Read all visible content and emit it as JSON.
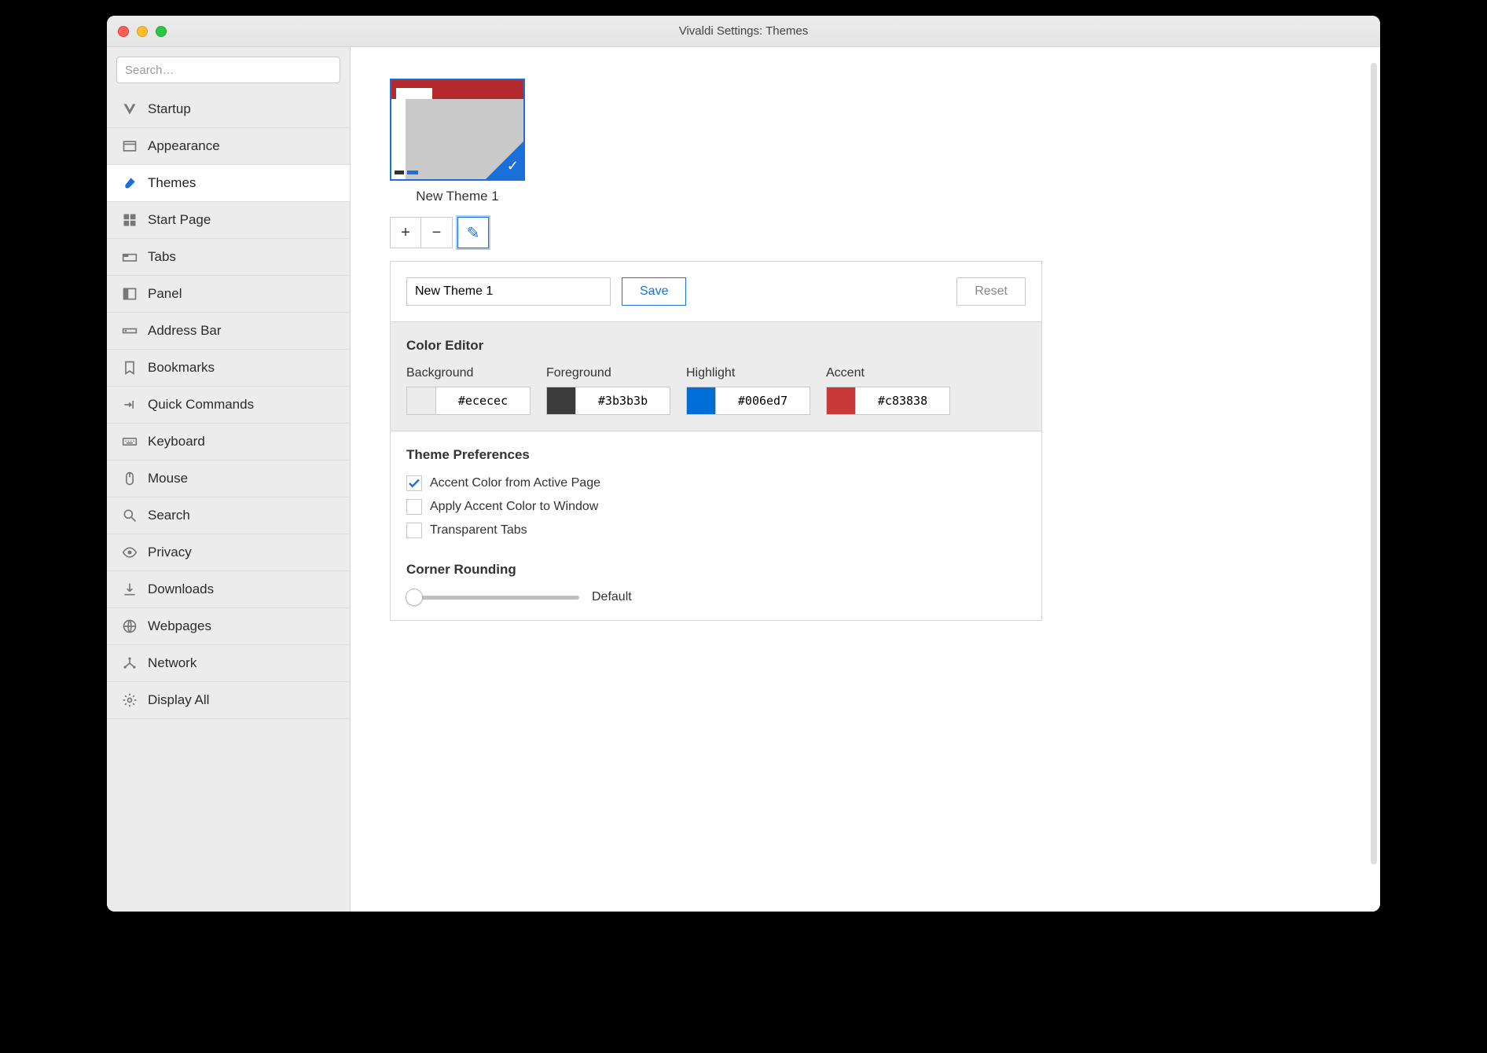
{
  "window": {
    "title": "Vivaldi Settings: Themes"
  },
  "search": {
    "placeholder": "Search…"
  },
  "sidebar": {
    "items": [
      {
        "label": "Startup",
        "icon": "vivaldi-icon"
      },
      {
        "label": "Appearance",
        "icon": "window-icon"
      },
      {
        "label": "Themes",
        "icon": "brush-icon",
        "active": true
      },
      {
        "label": "Start Page",
        "icon": "grid-icon"
      },
      {
        "label": "Tabs",
        "icon": "tabs-icon"
      },
      {
        "label": "Panel",
        "icon": "panel-icon"
      },
      {
        "label": "Address Bar",
        "icon": "address-icon"
      },
      {
        "label": "Bookmarks",
        "icon": "bookmark-icon"
      },
      {
        "label": "Quick Commands",
        "icon": "quick-icon"
      },
      {
        "label": "Keyboard",
        "icon": "keyboard-icon"
      },
      {
        "label": "Mouse",
        "icon": "mouse-icon"
      },
      {
        "label": "Search",
        "icon": "search-icon"
      },
      {
        "label": "Privacy",
        "icon": "eye-icon"
      },
      {
        "label": "Downloads",
        "icon": "download-icon"
      },
      {
        "label": "Webpages",
        "icon": "globe-icon"
      },
      {
        "label": "Network",
        "icon": "network-icon"
      },
      {
        "label": "Display All",
        "icon": "gear-icon"
      }
    ]
  },
  "theme": {
    "name": "New Theme 1"
  },
  "toolbar": {
    "add": "+",
    "remove": "−",
    "edit": "✎"
  },
  "editor": {
    "name_value": "New Theme 1",
    "save_label": "Save",
    "reset_label": "Reset",
    "color_editor_title": "Color Editor",
    "colors": {
      "background": {
        "label": "Background",
        "hex": "#ececec"
      },
      "foreground": {
        "label": "Foreground",
        "hex": "#3b3b3b"
      },
      "highlight": {
        "label": "Highlight",
        "hex": "#006ed7"
      },
      "accent": {
        "label": "Accent",
        "hex": "#c83838"
      }
    },
    "prefs_title": "Theme Preferences",
    "prefs": {
      "accent_from_page": {
        "label": "Accent Color from Active Page",
        "checked": true
      },
      "apply_to_window": {
        "label": "Apply Accent Color to Window",
        "checked": false
      },
      "transparent_tabs": {
        "label": "Transparent Tabs",
        "checked": false
      }
    },
    "rounding_title": "Corner Rounding",
    "rounding_value_label": "Default"
  }
}
